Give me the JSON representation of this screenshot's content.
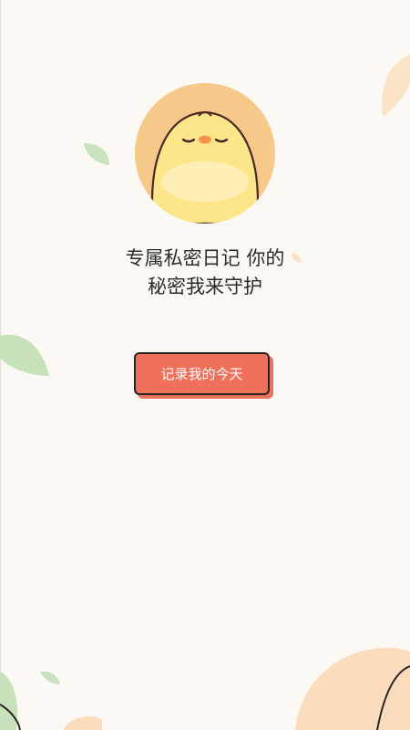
{
  "intro": {
    "tagline_line1": "专属私密日记 你的",
    "tagline_line2": "秘密我来守护",
    "cta_label": "记录我的今天",
    "avatar_icon": "chick-avatar-icon"
  },
  "colors": {
    "background": "#fcf9f4",
    "button": "#f0705c",
    "button_border": "#2b2321",
    "leaf_green": "#c7e2bb",
    "peach": "#fbdcbc"
  }
}
